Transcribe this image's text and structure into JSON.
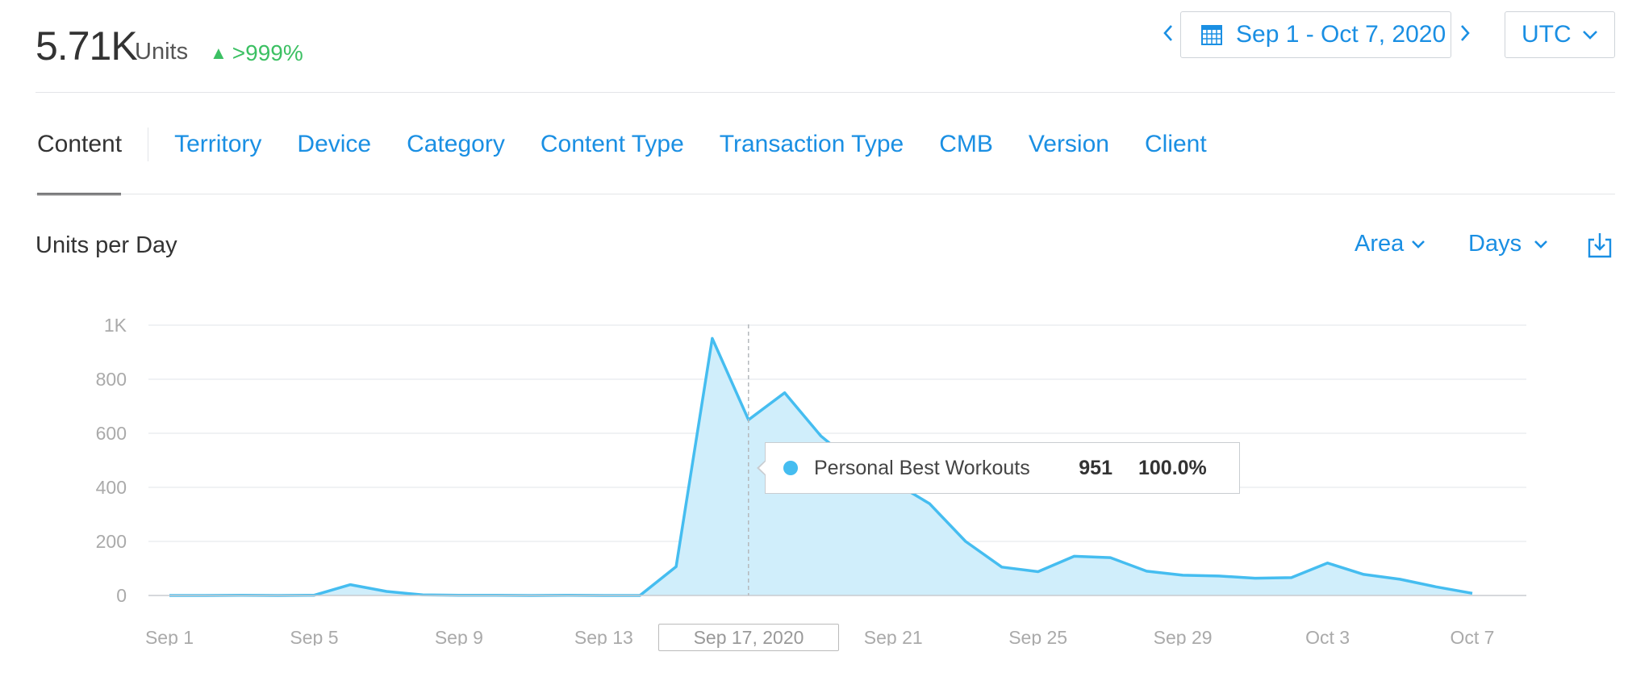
{
  "header": {
    "total_value": "5.71K",
    "total_unit": "Units",
    "change_text": ">999%",
    "change_icon": "triangle-up-icon",
    "date_range": "Sep 1 - Oct 7, 2020",
    "timezone": "UTC"
  },
  "tabs": [
    "Content",
    "Territory",
    "Device",
    "Category",
    "Content Type",
    "Transaction Type",
    "CMB",
    "Version",
    "Client"
  ],
  "chart_header": {
    "title": "Units per Day",
    "chart_type_label": "Area",
    "interval_label": "Days"
  },
  "tooltip": {
    "series_name": "Personal Best Workouts",
    "value": "951",
    "percent": "100.0%"
  },
  "selected_date_label": "Sep 17, 2020",
  "colors": {
    "accent": "#1a8fe3",
    "positive": "#3cc063",
    "series_line": "#45bdf0",
    "series_fill": "#cdedfb"
  },
  "chart_data": {
    "type": "area",
    "title": "Units per Day",
    "xlabel": "",
    "ylabel": "",
    "y_ticks": [
      "0",
      "200",
      "400",
      "600",
      "800",
      "1K"
    ],
    "ylim": [
      0,
      1000
    ],
    "x_tick_labels": [
      "Sep 1",
      "Sep 5",
      "Sep 9",
      "Sep 13",
      "Sep 21",
      "Sep 25",
      "Sep 29",
      "Oct 3",
      "Oct 7"
    ],
    "x_tick_dates": [
      "Sep 1",
      "Sep 5",
      "Sep 9",
      "Sep 13",
      "Sep 21",
      "Sep 25",
      "Sep 29",
      "Oct 3",
      "Oct 7"
    ],
    "grid": true,
    "x": [
      "Sep 1",
      "Sep 2",
      "Sep 3",
      "Sep 4",
      "Sep 5",
      "Sep 6",
      "Sep 7",
      "Sep 8",
      "Sep 9",
      "Sep 10",
      "Sep 11",
      "Sep 12",
      "Sep 13",
      "Sep 14",
      "Sep 15",
      "Sep 16",
      "Sep 17",
      "Sep 18",
      "Sep 19",
      "Sep 20",
      "Sep 21",
      "Sep 22",
      "Sep 23",
      "Sep 24",
      "Sep 25",
      "Sep 26",
      "Sep 27",
      "Sep 28",
      "Sep 29",
      "Sep 30",
      "Oct 1",
      "Oct 2",
      "Oct 3",
      "Oct 4",
      "Oct 5",
      "Oct 6",
      "Oct 7"
    ],
    "series": [
      {
        "name": "Personal Best Workouts",
        "values": [
          0,
          0,
          1,
          0,
          1,
          40,
          15,
          2,
          1,
          1,
          0,
          1,
          0,
          0,
          107,
          951,
          650,
          750,
          590,
          480,
          420,
          340,
          200,
          105,
          88,
          145,
          140,
          90,
          75,
          72,
          64,
          66,
          120,
          78,
          60,
          32,
          8
        ]
      }
    ],
    "selected_x": "Sep 17"
  }
}
